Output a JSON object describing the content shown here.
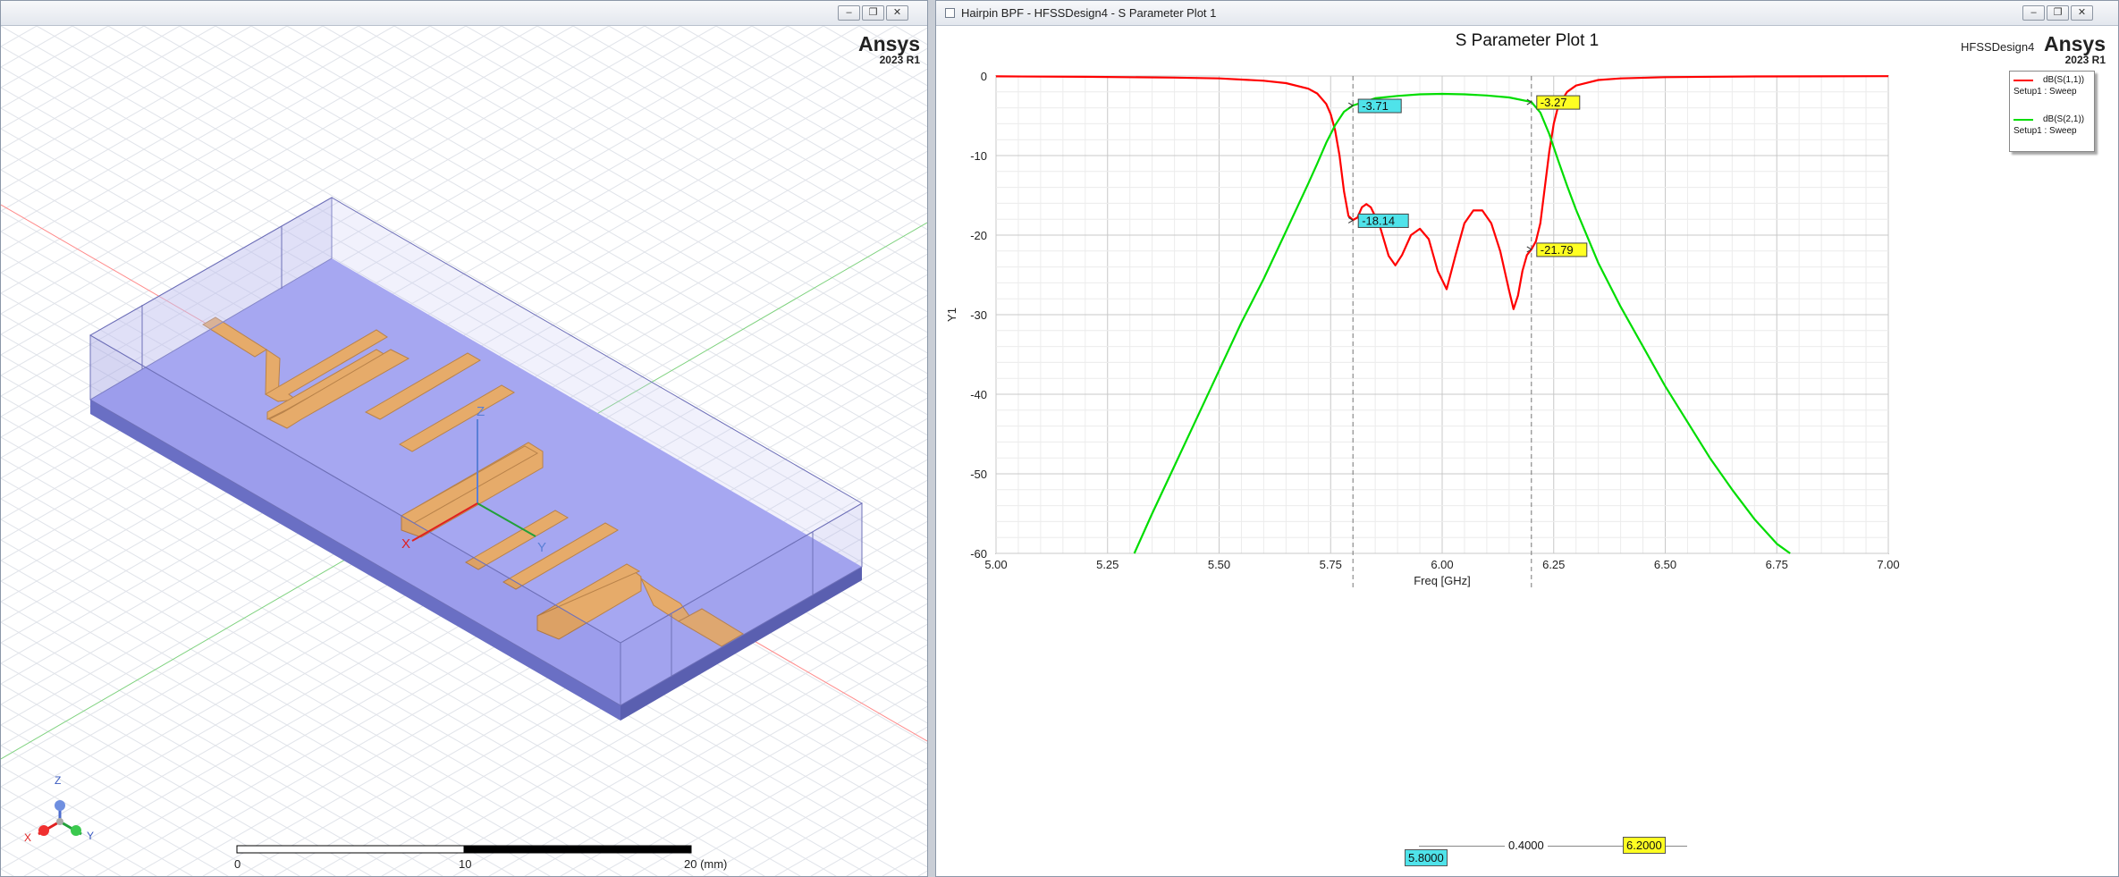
{
  "left_window": {
    "title": "",
    "brand": "Ansys",
    "version": "2023 R1",
    "model": {
      "axis_labels": {
        "x": "X",
        "y": "Y",
        "z": "Z"
      }
    },
    "triad_labels": {
      "x": "X",
      "y": "Y",
      "z": "Z"
    },
    "ruler": {
      "labels": [
        "0",
        "10",
        "20 (mm)"
      ]
    }
  },
  "right_window": {
    "title": "Hairpin BPF - HFSSDesign4 - S Parameter Plot 1",
    "brand": "Ansys",
    "version": "2023 R1",
    "design_name": "HFSSDesign4",
    "legend": [
      {
        "name": "dB(S(1,1))",
        "sub": "Setup1 : Sweep",
        "color": "#ff0000"
      },
      {
        "name": "dB(S(2,1))",
        "sub": "Setup1 : Sweep",
        "color": "#00dd00"
      }
    ],
    "bottom_markers": {
      "m1": "5.8000",
      "m2": "6.2000",
      "delta": "0.4000"
    }
  },
  "window_buttons": {
    "minimize": "–",
    "restore": "❐",
    "close": "✕"
  },
  "chart_data": {
    "type": "line",
    "title": "S Parameter Plot 1",
    "xlabel": "Freq [GHz]",
    "ylabel": "Y1",
    "xlim": [
      5.0,
      7.0
    ],
    "ylim": [
      -60,
      0
    ],
    "xticks": [
      "5.00",
      "5.25",
      "5.50",
      "5.75",
      "6.00",
      "6.25",
      "6.50",
      "6.75",
      "7.00"
    ],
    "yticks": [
      "0",
      "-10",
      "-20",
      "-30",
      "-40",
      "-50",
      "-60"
    ],
    "grid": true,
    "legend_position": "top-right",
    "series": [
      {
        "name": "dB(S(1,1))",
        "color": "#ff0000",
        "x": [
          5.0,
          5.2,
          5.4,
          5.5,
          5.6,
          5.65,
          5.7,
          5.72,
          5.74,
          5.75,
          5.76,
          5.77,
          5.78,
          5.79,
          5.8,
          5.81,
          5.82,
          5.83,
          5.84,
          5.86,
          5.88,
          5.895,
          5.91,
          5.93,
          5.95,
          5.97,
          5.99,
          6.01,
          6.03,
          6.05,
          6.07,
          6.09,
          6.11,
          6.13,
          6.15,
          6.16,
          6.17,
          6.18,
          6.19,
          6.2,
          6.21,
          6.22,
          6.23,
          6.24,
          6.25,
          6.26,
          6.28,
          6.3,
          6.35,
          6.4,
          6.5,
          6.7,
          7.0
        ],
        "y": [
          -0.05,
          -0.1,
          -0.2,
          -0.3,
          -0.6,
          -0.9,
          -1.6,
          -2.2,
          -3.5,
          -4.8,
          -6.8,
          -10.0,
          -14.5,
          -17.6,
          -18.1,
          -17.8,
          -16.5,
          -16.1,
          -16.5,
          -18.8,
          -22.6,
          -23.8,
          -22.5,
          -20.0,
          -19.2,
          -20.5,
          -24.5,
          -26.8,
          -22.5,
          -18.5,
          -16.9,
          -16.9,
          -18.5,
          -22.0,
          -27.0,
          -29.3,
          -27.6,
          -24.5,
          -22.5,
          -21.8,
          -20.8,
          -18.5,
          -14.0,
          -9.5,
          -6.0,
          -3.8,
          -2.0,
          -1.2,
          -0.5,
          -0.3,
          -0.15,
          -0.06,
          -0.02
        ]
      },
      {
        "name": "dB(S(2,1))",
        "color": "#00dd00",
        "x": [
          5.31,
          5.35,
          5.4,
          5.45,
          5.5,
          5.55,
          5.6,
          5.65,
          5.7,
          5.72,
          5.74,
          5.76,
          5.78,
          5.8,
          5.85,
          5.9,
          5.95,
          6.0,
          6.05,
          6.1,
          6.15,
          6.2,
          6.22,
          6.24,
          6.26,
          6.28,
          6.3,
          6.35,
          6.4,
          6.45,
          6.5,
          6.55,
          6.6,
          6.65,
          6.7,
          6.75,
          6.78
        ],
        "y": [
          -60,
          -55,
          -49,
          -43,
          -37,
          -31,
          -25.5,
          -19.5,
          -13.5,
          -11.0,
          -8.4,
          -6.2,
          -4.5,
          -3.71,
          -2.8,
          -2.5,
          -2.3,
          -2.25,
          -2.3,
          -2.45,
          -2.7,
          -3.27,
          -4.6,
          -7.3,
          -10.6,
          -13.8,
          -16.8,
          -23.5,
          -29.0,
          -34.0,
          -39.0,
          -43.5,
          -48.0,
          -52.0,
          -55.7,
          -58.8,
          -60
        ]
      }
    ],
    "markers": [
      {
        "x": 5.8,
        "label": "-3.71",
        "y": -3.71,
        "color": "#4fe3ea"
      },
      {
        "x": 5.8,
        "label": "-18.14",
        "y": -18.14,
        "color": "#4fe3ea"
      },
      {
        "x": 6.2,
        "label": "-3.27",
        "y": -3.27,
        "color": "#ffff22"
      },
      {
        "x": 6.2,
        "label": "-21.79",
        "y": -21.79,
        "color": "#ffff22"
      }
    ]
  }
}
